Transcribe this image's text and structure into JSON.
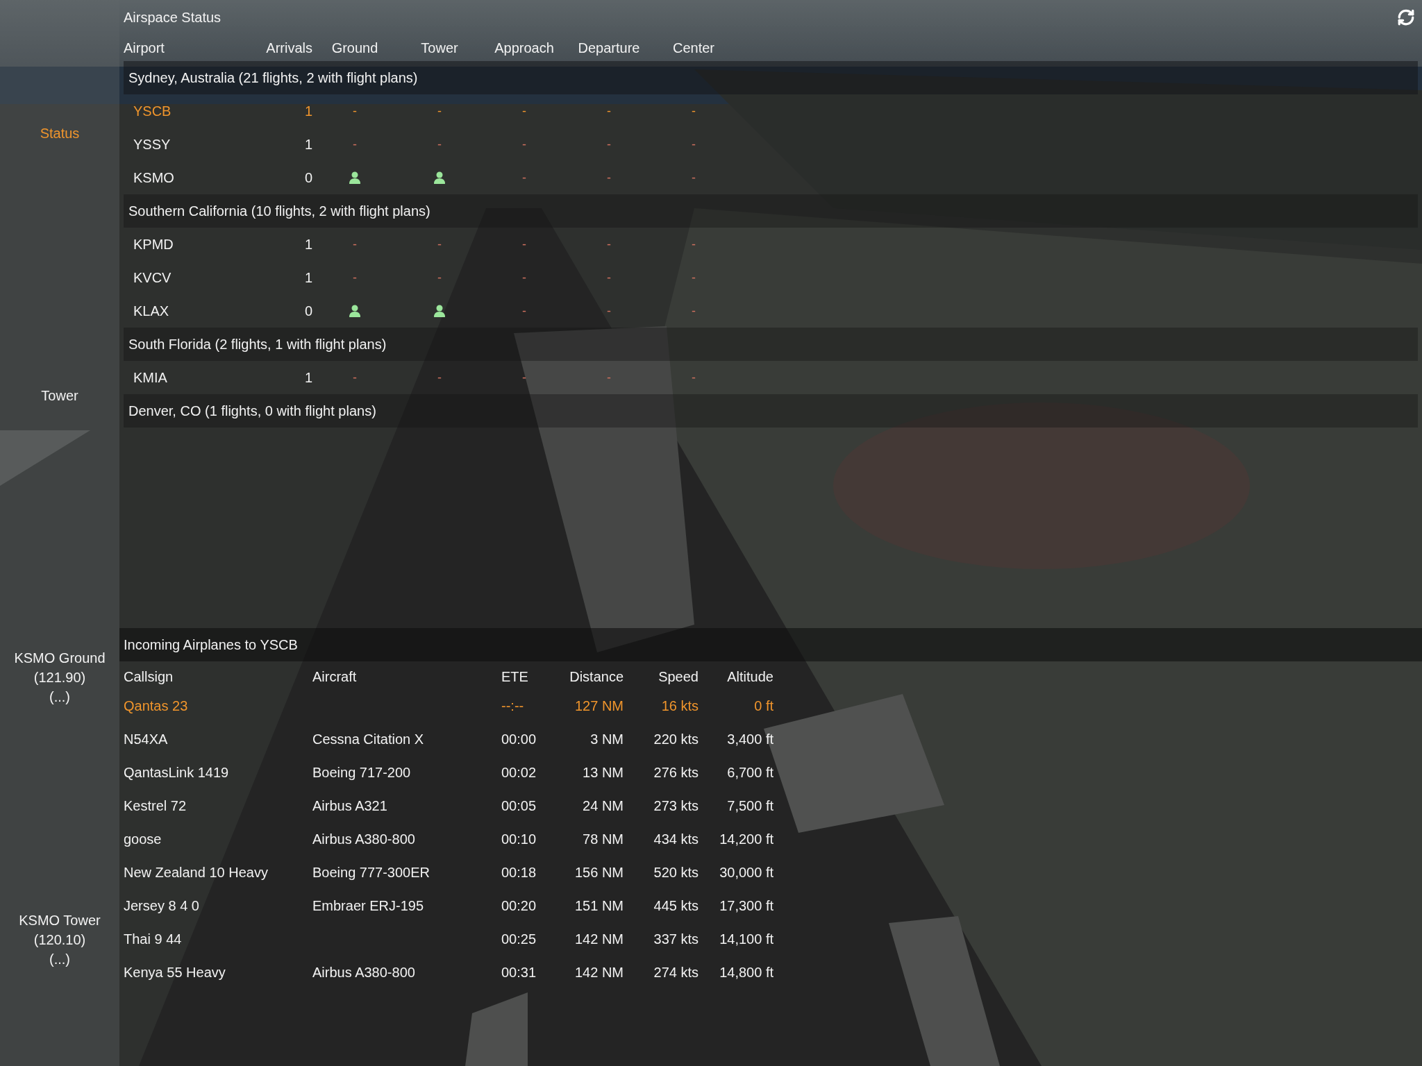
{
  "sidebar": {
    "items": [
      {
        "lines": [
          "Status"
        ],
        "selected": true
      },
      {
        "lines": [
          "Tower"
        ],
        "selected": false
      },
      {
        "lines": [
          "KSMO Ground",
          "(121.90)",
          "(...)"
        ],
        "selected": false
      },
      {
        "lines": [
          "KSMO Tower",
          "(120.10)",
          "(...)"
        ],
        "selected": false
      }
    ]
  },
  "airspace": {
    "title": "Airspace Status",
    "columns": [
      "Airport",
      "Arrivals",
      "Ground",
      "Tower",
      "Approach",
      "Departure",
      "Center"
    ],
    "regions": [
      {
        "label": "Sydney, Australia (21 flights, 2 with flight plans)",
        "airports": [
          {
            "code": "YSCB",
            "arrivals": "1",
            "selected": true,
            "positions": [
              {
                "kind": "vacant",
                "text": "-"
              },
              {
                "kind": "vacant",
                "text": "-"
              },
              {
                "kind": "vacant",
                "text": "-"
              },
              {
                "kind": "vacant",
                "text": "-"
              },
              {
                "kind": "vacant",
                "text": "-"
              }
            ]
          },
          {
            "code": "YSSY",
            "arrivals": "1",
            "selected": false,
            "positions": [
              {
                "kind": "vacant",
                "text": "-"
              },
              {
                "kind": "vacant",
                "text": "-"
              },
              {
                "kind": "vacant",
                "text": "-"
              },
              {
                "kind": "vacant",
                "text": "-"
              },
              {
                "kind": "vacant",
                "text": "-"
              }
            ]
          },
          {
            "code": "KSMO",
            "arrivals": "0",
            "selected": false,
            "positions": [
              {
                "kind": "staffed"
              },
              {
                "kind": "staffed"
              },
              {
                "kind": "vacant",
                "text": "-"
              },
              {
                "kind": "vacant",
                "text": "-"
              },
              {
                "kind": "vacant",
                "text": "-"
              }
            ]
          }
        ]
      },
      {
        "label": "Southern California (10 flights, 2 with flight plans)",
        "airports": [
          {
            "code": "KPMD",
            "arrivals": "1",
            "selected": false,
            "positions": [
              {
                "kind": "vacant",
                "text": "-"
              },
              {
                "kind": "vacant",
                "text": "-"
              },
              {
                "kind": "vacant",
                "text": "-"
              },
              {
                "kind": "vacant",
                "text": "-"
              },
              {
                "kind": "vacant",
                "text": "-"
              }
            ]
          },
          {
            "code": "KVCV",
            "arrivals": "1",
            "selected": false,
            "positions": [
              {
                "kind": "vacant",
                "text": "-"
              },
              {
                "kind": "vacant",
                "text": "-"
              },
              {
                "kind": "vacant",
                "text": "-"
              },
              {
                "kind": "vacant",
                "text": "-"
              },
              {
                "kind": "vacant",
                "text": "-"
              }
            ]
          },
          {
            "code": "KLAX",
            "arrivals": "0",
            "selected": false,
            "positions": [
              {
                "kind": "staffed"
              },
              {
                "kind": "staffed"
              },
              {
                "kind": "vacant",
                "text": "-"
              },
              {
                "kind": "vacant",
                "text": "-"
              },
              {
                "kind": "vacant",
                "text": "-"
              }
            ]
          }
        ]
      },
      {
        "label": "South Florida (2 flights, 1 with flight plans)",
        "airports": [
          {
            "code": "KMIA",
            "arrivals": "1",
            "selected": false,
            "positions": [
              {
                "kind": "vacant",
                "text": "-"
              },
              {
                "kind": "vacant",
                "text": "-"
              },
              {
                "kind": "vacant",
                "text": "-"
              },
              {
                "kind": "vacant",
                "text": "-"
              },
              {
                "kind": "vacant",
                "text": "-"
              }
            ]
          }
        ]
      },
      {
        "label": "Denver, CO (1 flights, 0 with flight plans)"
      }
    ]
  },
  "incoming": {
    "title": "Incoming Airplanes to YSCB",
    "columns": [
      "Callsign",
      "Aircraft",
      "ETE",
      "Distance",
      "Speed",
      "Altitude"
    ],
    "rows": [
      {
        "callsign": "Qantas 23",
        "ete": "--:--",
        "distance": "127 NM",
        "speed": "16 kts",
        "altitude": "0 ft",
        "selected": true
      },
      {
        "callsign": "N54XA",
        "aircraft": "Cessna Citation X",
        "ete": "00:00",
        "distance": "3 NM",
        "speed": "220 kts",
        "altitude": "3,400 ft",
        "selected": false
      },
      {
        "callsign": "QantasLink 1419",
        "aircraft": "Boeing 717-200",
        "ete": "00:02",
        "distance": "13 NM",
        "speed": "276 kts",
        "altitude": "6,700 ft",
        "selected": false
      },
      {
        "callsign": "Kestrel 72",
        "aircraft": "Airbus A321",
        "ete": "00:05",
        "distance": "24 NM",
        "speed": "273 kts",
        "altitude": "7,500 ft",
        "selected": false
      },
      {
        "callsign": "goose",
        "aircraft": "Airbus A380-800",
        "ete": "00:10",
        "distance": "78 NM",
        "speed": "434 kts",
        "altitude": "14,200 ft",
        "selected": false
      },
      {
        "callsign": "New Zealand 10 Heavy",
        "aircraft": "Boeing 777-300ER",
        "ete": "00:18",
        "distance": "156 NM",
        "speed": "520 kts",
        "altitude": "30,000 ft",
        "selected": false
      },
      {
        "callsign": "Jersey 8 4 0",
        "aircraft": "Embraer ERJ-195",
        "ete": "00:20",
        "distance": "151 NM",
        "speed": "445 kts",
        "altitude": "17,300 ft",
        "selected": false
      },
      {
        "callsign": "Thai 9 44",
        "ete": "00:25",
        "distance": "142 NM",
        "speed": "337 kts",
        "altitude": "14,100 ft",
        "selected": false
      },
      {
        "callsign": "Kenya 55 Heavy",
        "aircraft": "Airbus A380-800",
        "ete": "00:31",
        "distance": "142 NM",
        "speed": "274 kts",
        "altitude": "14,800 ft",
        "selected": false
      }
    ]
  }
}
